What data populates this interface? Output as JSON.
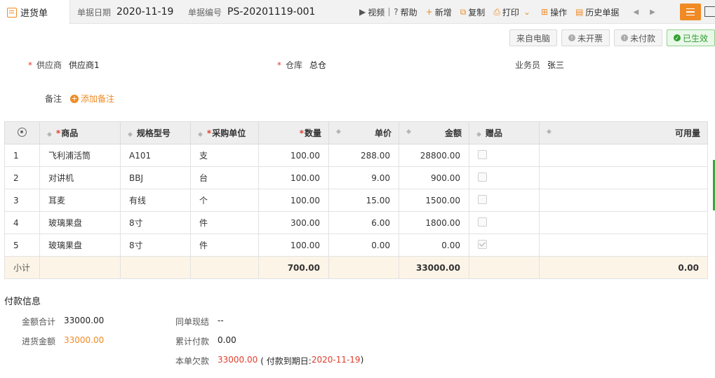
{
  "tab": {
    "title": "进货单"
  },
  "header": {
    "date_label": "单据日期",
    "date_value": "2020-11-19",
    "no_label": "单据编号",
    "no_value": "PS-20201119-001"
  },
  "toolbar": {
    "video": "视频",
    "help": "帮助",
    "add": "新增",
    "copy": "复制",
    "print": "打印",
    "operate": "操作",
    "history": "历史单据"
  },
  "status": {
    "source": "来自电脑",
    "invoice": "未开票",
    "payment": "未付款",
    "effective": "已生效"
  },
  "form": {
    "supplier_label": "供应商",
    "supplier_value": "供应商1",
    "warehouse_label": "仓库",
    "warehouse_value": "总仓",
    "salesman_label": "业务员",
    "salesman_value": "张三",
    "remark_label": "备注",
    "add_remark": "添加备注"
  },
  "table": {
    "headers": {
      "product": "商品",
      "spec": "规格型号",
      "unit": "采购单位",
      "qty": "数量",
      "price": "单价",
      "amount": "金额",
      "gift": "赠品",
      "available": "可用量"
    },
    "rows": [
      {
        "no": "1",
        "product": "飞利浦活筒",
        "spec": "A101",
        "unit": "支",
        "qty": "100.00",
        "price": "288.00",
        "amount": "28800.00",
        "gift": false,
        "available": ""
      },
      {
        "no": "2",
        "product": "对讲机",
        "spec": "BBJ",
        "unit": "台",
        "qty": "100.00",
        "price": "9.00",
        "amount": "900.00",
        "gift": false,
        "available": ""
      },
      {
        "no": "3",
        "product": "耳麦",
        "spec": "有线",
        "unit": "个",
        "qty": "100.00",
        "price": "15.00",
        "amount": "1500.00",
        "gift": false,
        "available": ""
      },
      {
        "no": "4",
        "product": "玻璃果盘",
        "spec": "8寸",
        "unit": "件",
        "qty": "300.00",
        "price": "6.00",
        "amount": "1800.00",
        "gift": false,
        "available": ""
      },
      {
        "no": "5",
        "product": "玻璃果盘",
        "spec": "8寸",
        "unit": "件",
        "qty": "100.00",
        "price": "0.00",
        "amount": "0.00",
        "gift": true,
        "available": ""
      }
    ],
    "subtotal": {
      "label": "小计",
      "qty": "700.00",
      "amount": "33000.00",
      "available": "0.00"
    }
  },
  "payment": {
    "title": "付款信息",
    "total_label": "金额合计",
    "total_value": "33000.00",
    "purchase_label": "进货金额",
    "purchase_value": "33000.00",
    "cash_label": "同单现结",
    "cash_value": "--",
    "paid_label": "累计付款",
    "paid_value": "0.00",
    "owed_label": "本单欠款",
    "owed_value": "33000.00",
    "due_prefix": "( 付款到期日: ",
    "due_value": "2020-11-19",
    "due_suffix": " )"
  }
}
